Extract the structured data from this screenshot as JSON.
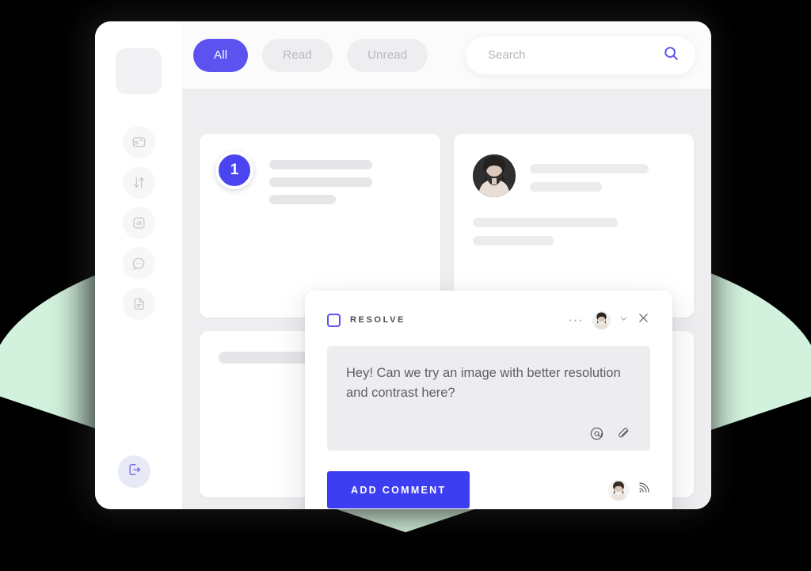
{
  "background": {
    "canvas_color": "#000000",
    "blob_color": "#d3f2dd"
  },
  "theme": {
    "accent": "#5b52f0",
    "accent_button": "#3d3ef2",
    "badge": "#4a45f0",
    "panel_bg": "#eeeef0",
    "card_bg": "#ffffff",
    "skeleton": "#e6e6e8"
  },
  "sidebar": {
    "logo": {
      "name": "logo-placeholder"
    },
    "items": [
      {
        "label": "Inbox",
        "icon": "inbox-icon"
      },
      {
        "label": "Transfers",
        "icon": "sort-arrows-icon"
      },
      {
        "label": "Reports",
        "icon": "chart-icon"
      },
      {
        "label": "Messages",
        "icon": "chat-bubble-icon"
      },
      {
        "label": "Documents",
        "icon": "document-icon"
      }
    ],
    "logout": {
      "label": "Log out",
      "icon": "logout-icon"
    }
  },
  "topbar": {
    "filters": [
      {
        "label": "All",
        "state": "active"
      },
      {
        "label": "Read",
        "state": "inactive"
      },
      {
        "label": "Unread",
        "state": "inactive"
      }
    ],
    "search": {
      "placeholder": "Search",
      "value": "",
      "icon": "search-icon"
    }
  },
  "main": {
    "cards": [
      {
        "name": "card-with-badge",
        "badge": "1",
        "skeleton_widths": [
          "68%",
          "68%",
          "44%"
        ]
      },
      {
        "name": "card-with-avatar",
        "avatar": "user-avatar",
        "skeleton_widths": [
          "82%",
          "50%",
          "72%",
          "40%"
        ]
      },
      {
        "name": "card-lower-left",
        "skeleton_widths": [
          "56%",
          "74%",
          "62%"
        ]
      },
      {
        "name": "card-lower-right",
        "skeleton_widths": [
          "46%",
          "80%",
          "78%"
        ]
      }
    ]
  },
  "comment_popup": {
    "resolve": {
      "label": "RESOLVE",
      "checked": false,
      "icon": "checkbox-icon"
    },
    "more": {
      "label": "···",
      "icon": "ellipsis-icon"
    },
    "assignee": {
      "icon": "avatar",
      "chevron": "chevron-down-icon"
    },
    "close": {
      "icon": "close-icon"
    },
    "message": "Hey! Can we try an image with better resolution and contrast here?",
    "message_actions": [
      {
        "label": "Mention",
        "icon": "at-mention-icon"
      },
      {
        "label": "Attach file",
        "icon": "paperclip-icon"
      }
    ],
    "submit_label": "ADD COMMENT",
    "footer_icons": [
      {
        "label": "Author",
        "icon": "avatar"
      },
      {
        "label": "Broadcast",
        "icon": "broadcast-icon"
      }
    ]
  }
}
